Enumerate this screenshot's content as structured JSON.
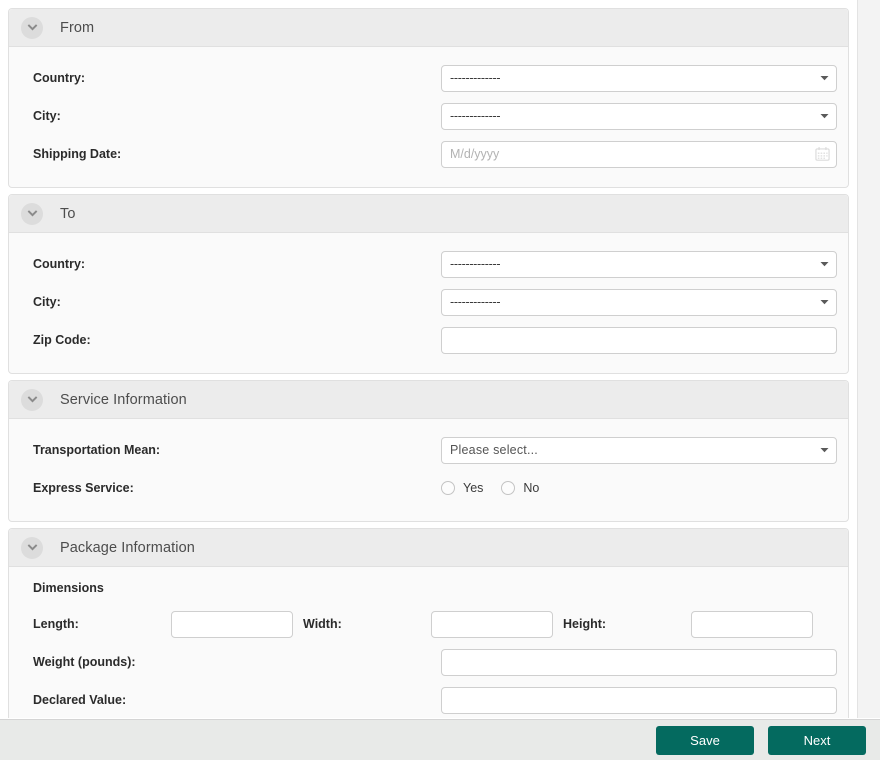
{
  "sections": [
    {
      "id": "from",
      "title": "From",
      "fields": [
        {
          "label": "Country:",
          "type": "select",
          "value": "-------------"
        },
        {
          "label": "City:",
          "type": "select",
          "value": "-------------"
        },
        {
          "label": "Shipping Date:",
          "type": "date",
          "placeholder": "M/d/yyyy"
        }
      ]
    },
    {
      "id": "to",
      "title": "To",
      "fields": [
        {
          "label": "Country:",
          "type": "select",
          "value": "-------------"
        },
        {
          "label": "City:",
          "type": "select",
          "value": "-------------"
        },
        {
          "label": "Zip Code:",
          "type": "text",
          "value": ""
        }
      ]
    },
    {
      "id": "service-information",
      "title": "Service Information",
      "fields": [
        {
          "label": "Transportation Mean:",
          "type": "select",
          "value": "Please select..."
        },
        {
          "label": "Express Service:",
          "type": "radio",
          "options": [
            "Yes",
            "No"
          ]
        }
      ]
    },
    {
      "id": "package-information",
      "title": "Package Information",
      "subheading": "Dimensions",
      "dimensions": {
        "length_label": "Length:",
        "width_label": "Width:",
        "height_label": "Height:",
        "length_value": "",
        "width_value": "",
        "height_value": ""
      },
      "fields": [
        {
          "label": "Weight (pounds):",
          "type": "text",
          "value": ""
        },
        {
          "label": "Declared Value:",
          "type": "text",
          "value": ""
        }
      ]
    }
  ],
  "footer": {
    "save_label": "Save",
    "next_label": "Next"
  },
  "colors": {
    "button": "#046a5f",
    "panel_header": "#ececec",
    "panel_body": "#fafafa",
    "footer": "#e8eae8"
  },
  "icons": {
    "collapse": "chevron-down-icon",
    "dropdown": "caret-down-icon",
    "calendar": "calendar-icon"
  }
}
